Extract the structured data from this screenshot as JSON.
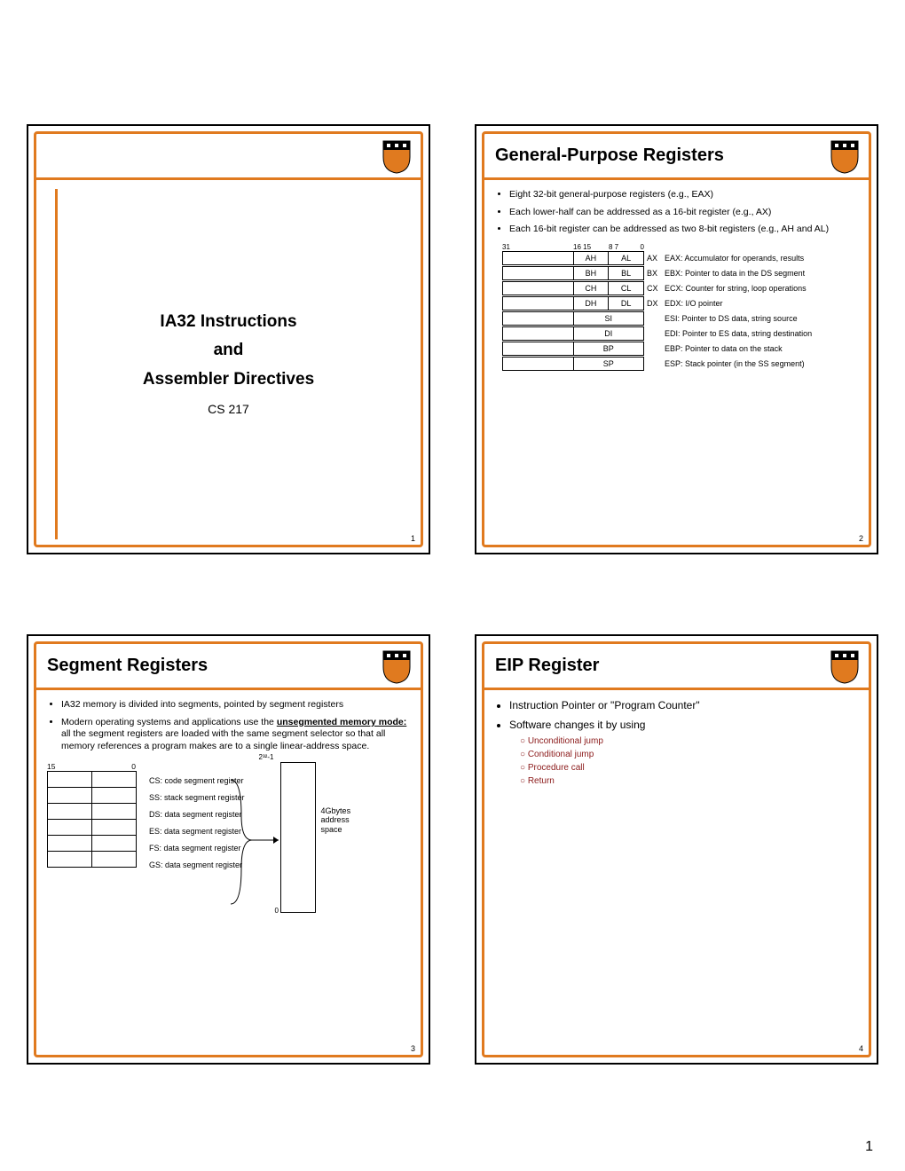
{
  "page_number": "1",
  "slide1": {
    "title_l1": "IA32 Instructions",
    "title_l2": "and",
    "title_l3": "Assembler Directives",
    "course": "CS 217",
    "pagenum": "1"
  },
  "slide2": {
    "title": "General-Purpose Registers",
    "b1": "Eight 32-bit general-purpose registers (e.g., EAX)",
    "b2": "Each lower-half can be addressed as a 16-bit register (e.g., AX)",
    "b3": "Each 16-bit register can be addressed as two 8-bit registers (e.g., AH and AL)",
    "bit31": "31",
    "bit1615": "16 15",
    "bit87": "8 7",
    "bit0": "0",
    "rows8": [
      {
        "h": "AH",
        "l": "AL",
        "x": "AX",
        "desc": "EAX: Accumulator for operands, results"
      },
      {
        "h": "BH",
        "l": "BL",
        "x": "BX",
        "desc": "EBX: Pointer to data in the DS segment"
      },
      {
        "h": "CH",
        "l": "CL",
        "x": "CX",
        "desc": "ECX: Counter for string, loop operations"
      },
      {
        "h": "DH",
        "l": "DL",
        "x": "DX",
        "desc": "EDX: I/O pointer"
      }
    ],
    "rows16": [
      {
        "r": "SI",
        "desc": "ESI:  Pointer to DS data, string source"
      },
      {
        "r": "DI",
        "desc": "EDI:  Pointer to ES data, string destination"
      },
      {
        "r": "BP",
        "desc": "EBP: Pointer to data on the stack"
      },
      {
        "r": "SP",
        "desc": "ESP: Stack pointer (in the SS segment)"
      }
    ],
    "pagenum": "2"
  },
  "slide3": {
    "title": "Segment Registers",
    "b1": "IA32 memory is divided into segments, pointed by segment registers",
    "b2a": "Modern operating systems and applications use the ",
    "b2b": "unsegmented memory mode:",
    "b2c": " all the segment registers are loaded with the same segment selector so that all memory references a program makes are to a single linear-address space.",
    "bit15": "15",
    "bit0": "0",
    "segs": [
      "CS: code segment register",
      "SS: stack segment register",
      "DS: data segment register",
      "ES: data segment register",
      "FS: data segment register",
      "GS: data segment register"
    ],
    "top": "2³²-1",
    "bot": "0",
    "space_l1": "4Gbytes",
    "space_l2": "address",
    "space_l3": "space",
    "pagenum": "3"
  },
  "slide4": {
    "title": "EIP Register",
    "b1": "Instruction Pointer or \"Program Counter\"",
    "b2": "Software changes it by using",
    "sub": [
      "Unconditional jump",
      "Conditional jump",
      "Procedure call",
      "Return"
    ],
    "pagenum": "4"
  }
}
